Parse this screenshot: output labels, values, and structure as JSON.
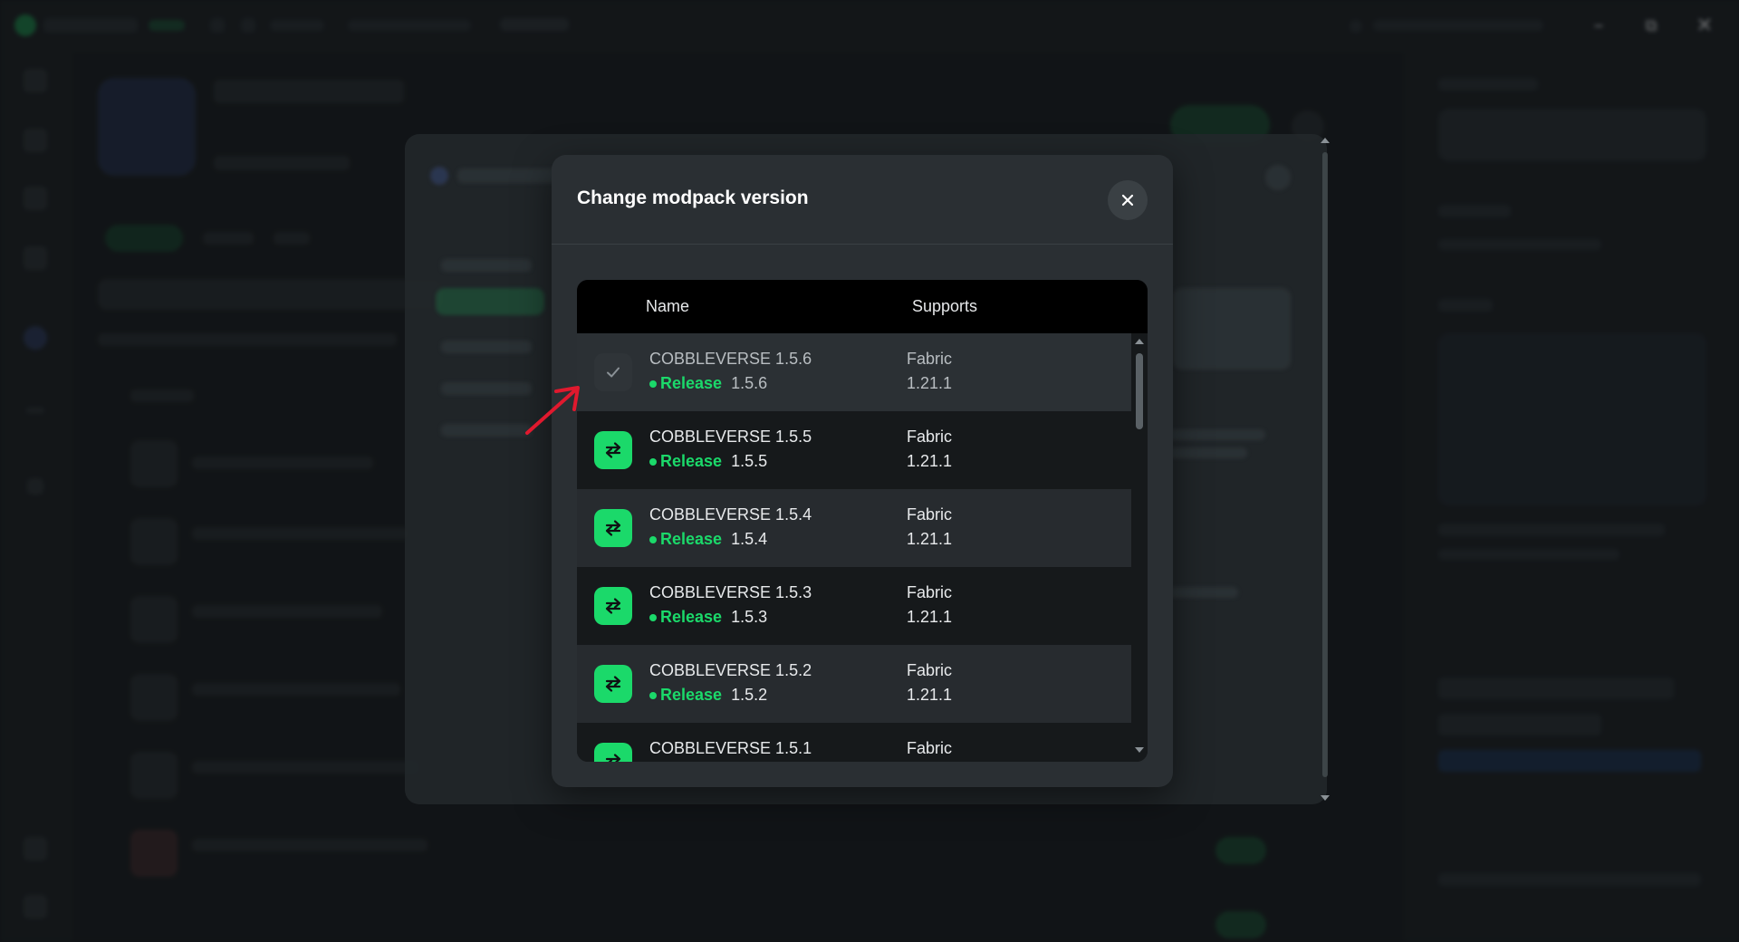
{
  "colors": {
    "accent": "#1bd96a",
    "annotation_arrow": "#e0192e",
    "dialog_bg": "#2a2f33"
  },
  "dialog": {
    "title": "Change modpack version",
    "close_icon": "close-icon"
  },
  "table": {
    "columns": [
      "Name",
      "Supports"
    ],
    "rows": [
      {
        "name": "COBBLEVERSE 1.5.6",
        "channel": "Release",
        "version": "1.5.6",
        "loader": "Fabric",
        "game_version": "1.21.1",
        "state": "installed",
        "icon": "check-icon"
      },
      {
        "name": "COBBLEVERSE 1.5.5",
        "channel": "Release",
        "version": "1.5.5",
        "loader": "Fabric",
        "game_version": "1.21.1",
        "state": "switchable",
        "icon": "swap-icon"
      },
      {
        "name": "COBBLEVERSE 1.5.4",
        "channel": "Release",
        "version": "1.5.4",
        "loader": "Fabric",
        "game_version": "1.21.1",
        "state": "switchable",
        "icon": "swap-icon"
      },
      {
        "name": "COBBLEVERSE 1.5.3",
        "channel": "Release",
        "version": "1.5.3",
        "loader": "Fabric",
        "game_version": "1.21.1",
        "state": "switchable",
        "icon": "swap-icon"
      },
      {
        "name": "COBBLEVERSE 1.5.2",
        "channel": "Release",
        "version": "1.5.2",
        "loader": "Fabric",
        "game_version": "1.21.1",
        "state": "switchable",
        "icon": "swap-icon"
      },
      {
        "name": "COBBLEVERSE 1.5.1",
        "loader": "Fabric",
        "state": "switchable",
        "icon": "swap-icon"
      }
    ]
  },
  "window_controls": {
    "minimize": "minimize-icon",
    "maximize": "maximize-icon",
    "close": "window-close-icon"
  }
}
